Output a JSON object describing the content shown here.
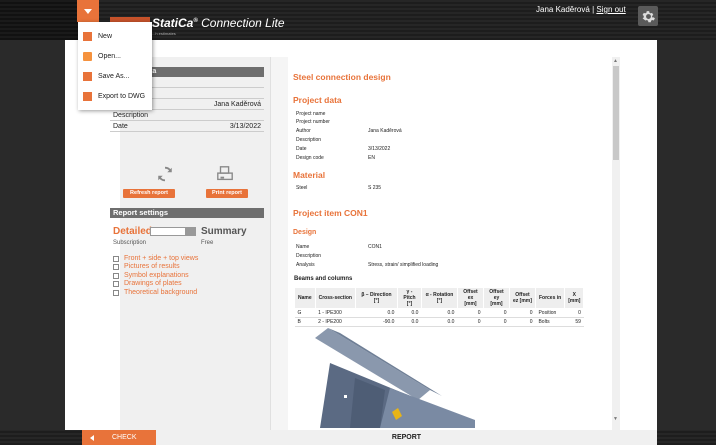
{
  "app": {
    "title": "StatiCa",
    "title_registered": "®",
    "subtitle": "Connection Lite",
    "tagline": "...h estimates",
    "user_name": "Jana Kaděrová",
    "separator": "|",
    "signout_label": "Sign out",
    "accent_color": "#e8733a"
  },
  "file_menu": {
    "items": [
      {
        "label": "New",
        "icon": "new-file-icon"
      },
      {
        "label": "Open...",
        "icon": "folder-icon"
      },
      {
        "label": "Save As...",
        "icon": "save-icon"
      },
      {
        "label": "Export to DWG",
        "icon": "export-icon"
      }
    ]
  },
  "project_data_panel": {
    "header": "ta",
    "rows": [
      {
        "label": "",
        "value": ""
      },
      {
        "label": "",
        "value": ""
      },
      {
        "label": "",
        "value": "Jana Kaděrová"
      },
      {
        "label": "Description",
        "value": ""
      },
      {
        "label": "Date",
        "value": "3/13/2022"
      }
    ]
  },
  "actions": {
    "refresh_label": "Refresh report",
    "print_label": "Print report"
  },
  "report_settings": {
    "header": "Report settings",
    "detailed_label": "Detailed",
    "summary_label": "Summary",
    "detailed_sub": "Subscription",
    "summary_sub": "Free",
    "options": [
      "Front + side + top views",
      "Pictures of results",
      "Symbol explanations",
      "Drawings of plates",
      "Theoretical background"
    ]
  },
  "report": {
    "title": "Steel connection design",
    "project_data_heading": "Project data",
    "project_rows": [
      {
        "label": "Project name",
        "value": ""
      },
      {
        "label": "Project number",
        "value": ""
      },
      {
        "label": "Author",
        "value": "Jana Kaděrová"
      },
      {
        "label": "Description",
        "value": ""
      },
      {
        "label": "Date",
        "value": "3/13/2022"
      },
      {
        "label": "Design code",
        "value": "EN"
      }
    ],
    "material_heading": "Material",
    "material_rows": [
      {
        "label": "Steel",
        "value": "S 235"
      }
    ],
    "item_heading": "Project item CON1",
    "design_heading": "Design",
    "design_rows": [
      {
        "label": "Name",
        "value": "CON1"
      },
      {
        "label": "Description",
        "value": ""
      },
      {
        "label": "Analysis",
        "value": "Stress, strain/ simplified loading"
      }
    ],
    "beams_heading": "Beams and columns",
    "beams_table": {
      "headers": [
        "Name",
        "Cross-section",
        "β – Direction [°]",
        "γ - Pitch [°]",
        "α - Rotation [°]",
        "Offset ex [mm]",
        "Offset ey [mm]",
        "Offset ez [mm]",
        "Forces in",
        "X [mm]"
      ],
      "rows": [
        [
          "G",
          "1 - IPE300",
          "0.0",
          "0.0",
          "0.0",
          "0",
          "0",
          "0",
          "Position",
          "0"
        ],
        [
          "B",
          "2 - IPE200",
          "-90.0",
          "0.0",
          "0.0",
          "0",
          "0",
          "0",
          "Bolts",
          "59"
        ]
      ]
    }
  },
  "bottom": {
    "check_label": "CHECK",
    "report_label": "REPORT"
  }
}
